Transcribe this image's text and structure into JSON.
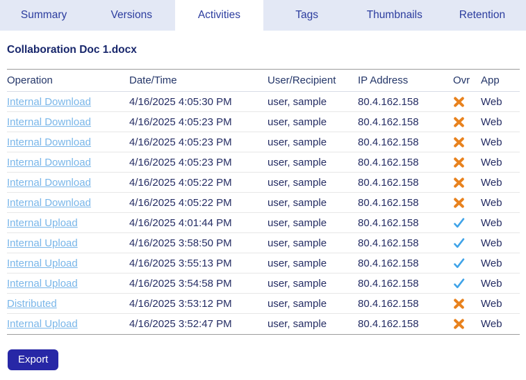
{
  "tabs": [
    {
      "label": "Summary",
      "active": false
    },
    {
      "label": "Versions",
      "active": false
    },
    {
      "label": "Activities",
      "active": true
    },
    {
      "label": "Tags",
      "active": false
    },
    {
      "label": "Thumbnails",
      "active": false
    },
    {
      "label": "Retention",
      "active": false
    }
  ],
  "page": {
    "document_title": "Collaboration Doc 1.docx"
  },
  "table": {
    "columns": [
      {
        "key": "operation",
        "label": "Operation"
      },
      {
        "key": "datetime",
        "label": "Date/Time"
      },
      {
        "key": "user_recipient",
        "label": "User/Recipient"
      },
      {
        "key": "ip_address",
        "label": "IP Address"
      },
      {
        "key": "ovr",
        "label": "Ovr"
      },
      {
        "key": "app",
        "label": "App"
      }
    ],
    "rows": [
      {
        "operation": "Internal Download",
        "datetime": "4/16/2025 4:05:30 PM",
        "user_recipient": "user, sample",
        "ip_address": "80.4.162.158",
        "ovr": "x",
        "app": "Web"
      },
      {
        "operation": "Internal Download",
        "datetime": "4/16/2025 4:05:23 PM",
        "user_recipient": "user, sample",
        "ip_address": "80.4.162.158",
        "ovr": "x",
        "app": "Web"
      },
      {
        "operation": "Internal Download",
        "datetime": "4/16/2025 4:05:23 PM",
        "user_recipient": "user, sample",
        "ip_address": "80.4.162.158",
        "ovr": "x",
        "app": "Web"
      },
      {
        "operation": "Internal Download",
        "datetime": "4/16/2025 4:05:23 PM",
        "user_recipient": "user, sample",
        "ip_address": "80.4.162.158",
        "ovr": "x",
        "app": "Web"
      },
      {
        "operation": "Internal Download",
        "datetime": "4/16/2025 4:05:22 PM",
        "user_recipient": "user, sample",
        "ip_address": "80.4.162.158",
        "ovr": "x",
        "app": "Web"
      },
      {
        "operation": "Internal Download",
        "datetime": "4/16/2025 4:05:22 PM",
        "user_recipient": "user, sample",
        "ip_address": "80.4.162.158",
        "ovr": "x",
        "app": "Web"
      },
      {
        "operation": "Internal Upload",
        "datetime": "4/16/2025 4:01:44 PM",
        "user_recipient": "user, sample",
        "ip_address": "80.4.162.158",
        "ovr": "check",
        "app": "Web"
      },
      {
        "operation": "Internal Upload",
        "datetime": "4/16/2025 3:58:50 PM",
        "user_recipient": "user, sample",
        "ip_address": "80.4.162.158",
        "ovr": "check",
        "app": "Web"
      },
      {
        "operation": "Internal Upload",
        "datetime": "4/16/2025 3:55:13 PM",
        "user_recipient": "user, sample",
        "ip_address": "80.4.162.158",
        "ovr": "check",
        "app": "Web"
      },
      {
        "operation": "Internal Upload",
        "datetime": "4/16/2025 3:54:58 PM",
        "user_recipient": "user, sample",
        "ip_address": "80.4.162.158",
        "ovr": "check",
        "app": "Web"
      },
      {
        "operation": "Distributed",
        "datetime": "4/16/2025 3:53:12 PM",
        "user_recipient": "user, sample",
        "ip_address": "80.4.162.158",
        "ovr": "x",
        "app": "Web"
      },
      {
        "operation": "Internal Upload",
        "datetime": "4/16/2025 3:52:47 PM",
        "user_recipient": "user, sample",
        "ip_address": "80.4.162.158",
        "ovr": "x",
        "app": "Web"
      }
    ]
  },
  "actions": {
    "export_label": "Export"
  },
  "icons": {
    "ovr_x": "x-icon",
    "ovr_check": "check-icon"
  },
  "colors": {
    "tabbar_bg": "#e3e8f5",
    "tab_text": "#2b3c9e",
    "title_text": "#17266b",
    "body_text": "#242c63",
    "link_color": "#79b6e9",
    "check_color": "#3fa3e8",
    "x_color": "#e8821e",
    "button_bg": "#2727a6",
    "button_text": "#ffffff"
  }
}
